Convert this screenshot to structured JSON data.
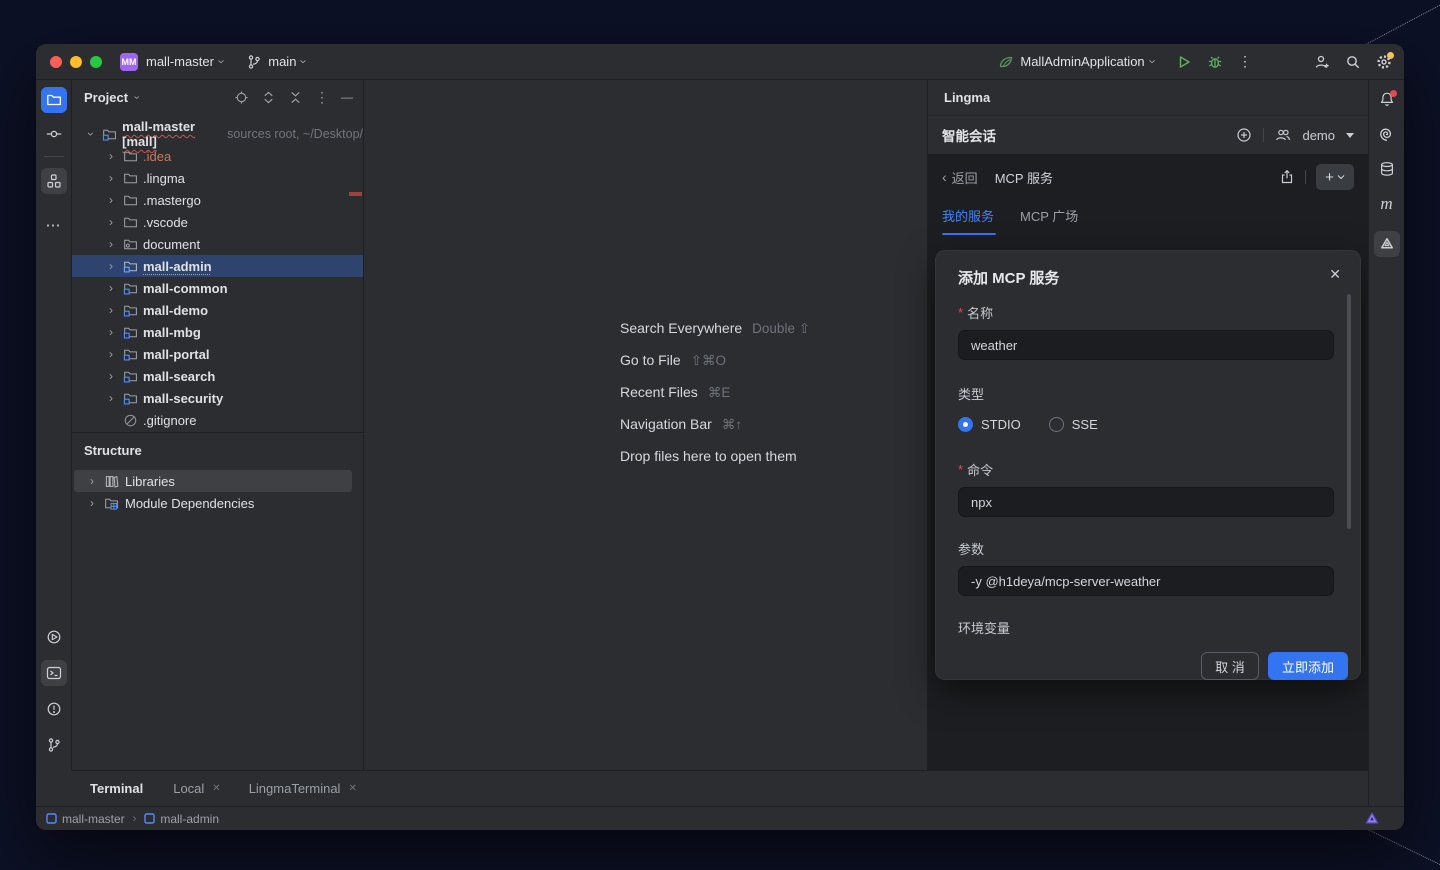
{
  "icons": {
    "chevron_right": "›",
    "back_chevron": "‹",
    "more_vertical": "⋮",
    "more_horizontal": "⋯",
    "hide": "—",
    "plus": "+",
    "close": "✕",
    "tab_close": "✕",
    "required": "*"
  },
  "titlebar": {
    "project_badge": "MM",
    "project_name": "mall-master",
    "branch_name": "main",
    "run_config": "MallAdminApplication"
  },
  "project_panel": {
    "title": "Project",
    "root": {
      "label": "mall-master [mall]",
      "suffix": "sources root, ~/Desktop/"
    },
    "tree": [
      {
        "label": ".idea"
      },
      {
        "label": ".lingma"
      },
      {
        "label": ".mastergo"
      },
      {
        "label": ".vscode"
      },
      {
        "label": "document"
      },
      {
        "label": "mall-admin"
      },
      {
        "label": "mall-common"
      },
      {
        "label": "mall-demo"
      },
      {
        "label": "mall-mbg"
      },
      {
        "label": "mall-portal"
      },
      {
        "label": "mall-search"
      },
      {
        "label": "mall-security"
      },
      {
        "label": ".gitignore"
      }
    ]
  },
  "structure_panel": {
    "title": "Structure",
    "items": [
      {
        "label": "Libraries"
      },
      {
        "label": "Module Dependencies"
      }
    ]
  },
  "editor": {
    "shortcuts": [
      {
        "label": "Search Everywhere",
        "keys": "Double ⇧"
      },
      {
        "label": "Go to File",
        "keys": "⇧⌘O"
      },
      {
        "label": "Recent Files",
        "keys": "⌘E"
      },
      {
        "label": "Navigation Bar",
        "keys": "⌘↑"
      },
      {
        "label": "Drop files here to open them",
        "keys": ""
      }
    ]
  },
  "lingma": {
    "panel_title": "Lingma",
    "session_title": "智能会话",
    "user": "demo",
    "back_label": "返回",
    "page_title": "MCP 服务",
    "tabs": [
      {
        "label": "我的服务"
      },
      {
        "label": "MCP 广场"
      }
    ],
    "dialog": {
      "title": "添加 MCP 服务",
      "name_label": "名称",
      "name_value": "weather",
      "type_label": "类型",
      "type_options": [
        {
          "label": "STDIO",
          "selected": true
        },
        {
          "label": "SSE",
          "selected": false
        }
      ],
      "command_label": "命令",
      "command_value": "npx",
      "args_label": "参数",
      "args_value": "-y @h1deya/mcp-server-weather",
      "env_label": "环境变量",
      "cancel_label": "取 消",
      "submit_label": "立即添加"
    }
  },
  "terminal": {
    "title": "Terminal",
    "tabs": [
      {
        "label": "Local"
      },
      {
        "label": "LingmaTerminal"
      }
    ]
  },
  "status_bar": {
    "breadcrumbs": [
      {
        "label": "mall-master"
      },
      {
        "label": "mall-admin"
      }
    ]
  },
  "colors": {
    "accent": "#3574F0",
    "selection": "#2E436E",
    "green": "#5FAD65",
    "required": "#E5484D",
    "badge_purple": "#9D67F2",
    "traffic_lights": [
      "#FF5F57",
      "#FEBC2E",
      "#28C840"
    ]
  }
}
